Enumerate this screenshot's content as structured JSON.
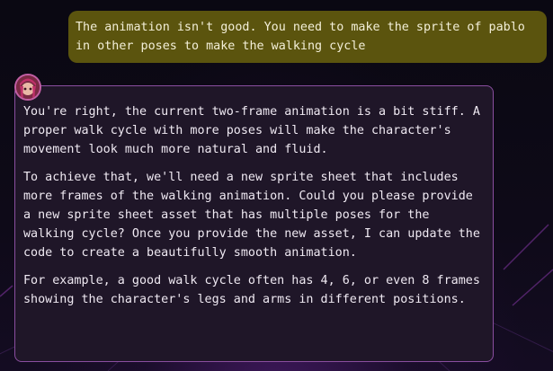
{
  "chat": {
    "user_message": "The animation isn't good. You need to make the sprite of pablo in other poses to make the walking cycle",
    "assistant": {
      "avatar_icon": "character-avatar-icon",
      "paragraphs": [
        "You're right, the current two-frame animation is a bit stiff. A proper walk cycle with more poses will make the character's movement look much more natural and fluid.",
        "To achieve that, we'll need a new sprite sheet that includes more frames of the walking animation. Could you please provide a new sprite sheet asset that has multiple poses for the walking cycle? Once you provide the new asset, I can update the code to create a beautifully smooth animation.",
        "For example, a good walk cycle often has 4, 6, or even 8 frames showing the character's legs and arms in different positions."
      ]
    }
  },
  "colors": {
    "background": "#0c0914",
    "user_bubble": "#5b540e",
    "assistant_bubble": "#1f1628",
    "assistant_border": "#8a4ea0",
    "text": "#efe9f2"
  }
}
